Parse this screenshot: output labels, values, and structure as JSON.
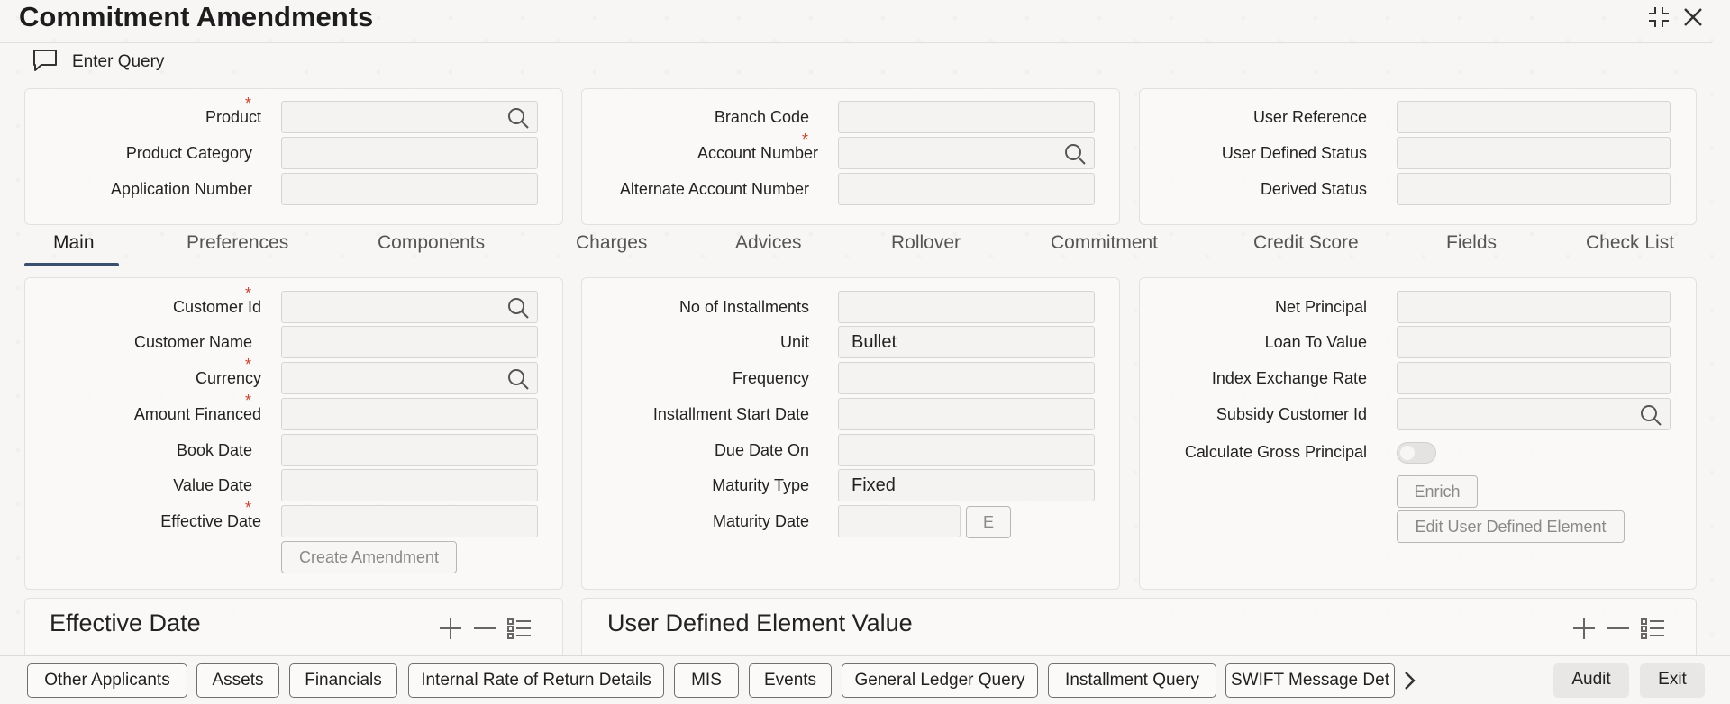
{
  "window": {
    "title": "Commitment Amendments"
  },
  "toolbar": {
    "enter_query": "Enter Query"
  },
  "header_panel": {
    "product": "Product",
    "product_category": "Product Category",
    "application_number": "Application Number",
    "branch_code": "Branch Code",
    "account_number": "Account Number",
    "alternate_account_number": "Alternate Account Number",
    "user_reference": "User Reference",
    "user_defined_status": "User Defined Status",
    "derived_status": "Derived Status",
    "required_mark": "*"
  },
  "tabs": [
    "Main",
    "Preferences",
    "Components",
    "Charges",
    "Advices",
    "Rollover",
    "Commitment",
    "Credit Score",
    "Fields",
    "Check List"
  ],
  "main": {
    "customer_id": "Customer Id",
    "customer_name": "Customer Name",
    "currency": "Currency",
    "amount_financed": "Amount Financed",
    "book_date": "Book Date",
    "value_date": "Value Date",
    "effective_date": "Effective Date",
    "create_amendment": "Create Amendment",
    "no_of_installments": "No of Installments",
    "unit": "Unit",
    "unit_value": "Bullet",
    "frequency": "Frequency",
    "installment_start_date": "Installment Start Date",
    "due_date_on": "Due Date On",
    "maturity_type": "Maturity Type",
    "maturity_type_value": "Fixed",
    "maturity_date": "Maturity Date",
    "e_button": "E",
    "net_principal": "Net Principal",
    "loan_to_value": "Loan To Value",
    "index_exchange_rate": "Index Exchange Rate",
    "subsidy_customer_id": "Subsidy Customer Id",
    "calculate_gross_principal": "Calculate Gross Principal",
    "enrich": "Enrich",
    "edit_user_defined_element": "Edit User Defined Element"
  },
  "sections": {
    "effective_date": "Effective Date",
    "user_defined_element_value": "User Defined Element Value"
  },
  "bottom_buttons": [
    "Other Applicants",
    "Assets",
    "Financials",
    "Internal Rate of Return Details",
    "MIS",
    "Events",
    "General Ledger Query",
    "Installment Query",
    "SWIFT Message Det"
  ],
  "footer": {
    "audit": "Audit",
    "exit": "Exit"
  },
  "icons": {
    "search": "search-icon",
    "chat": "chat-icon",
    "minimize": "minimize-icon",
    "close": "close-icon",
    "add": "plus-icon",
    "remove": "minus-icon",
    "list": "list-icon",
    "next": "chevron-right-icon"
  },
  "colors": {
    "required": "#c74634",
    "tab_active_underline": "#3a4e6e"
  }
}
